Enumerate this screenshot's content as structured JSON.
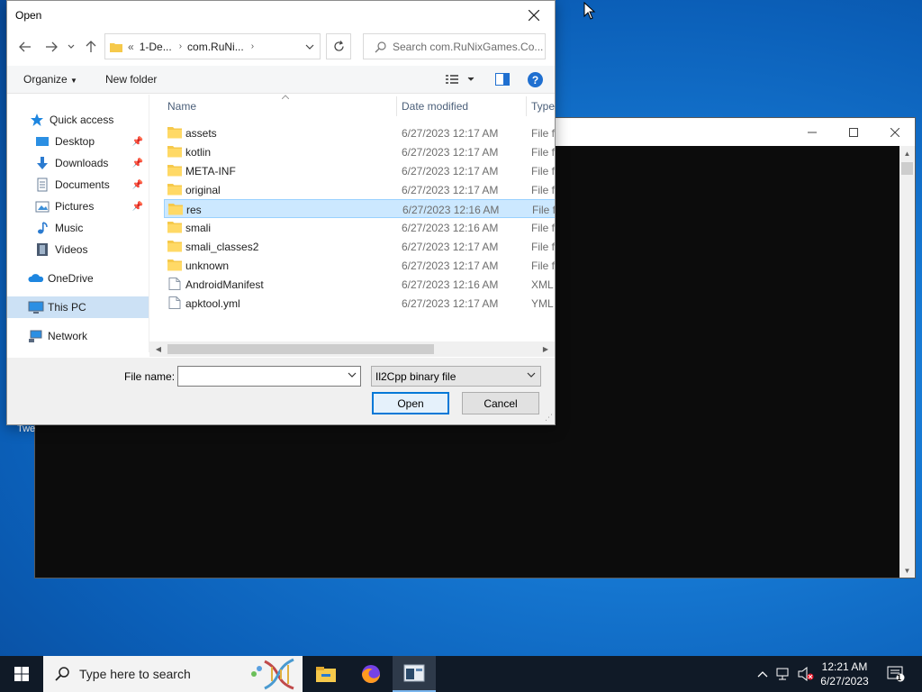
{
  "dialog": {
    "title": "Open",
    "address": {
      "overflow": "«",
      "crumbs": [
        "1-De...",
        "com.RuNi..."
      ]
    },
    "search_placeholder": "Search com.RuNixGames.Co...",
    "toolbar": {
      "organize": "Organize",
      "new_folder": "New folder"
    },
    "nav": {
      "quick_access": "Quick access",
      "desktop": "Desktop",
      "downloads": "Downloads",
      "documents": "Documents",
      "pictures": "Pictures",
      "music": "Music",
      "videos": "Videos",
      "onedrive": "OneDrive",
      "this_pc": "This PC",
      "network": "Network"
    },
    "columns": {
      "name": "Name",
      "date": "Date modified",
      "type": "Type"
    },
    "rows": [
      {
        "name": "assets",
        "date": "6/27/2023 12:17 AM",
        "type": "File fo",
        "icon": "folder-icon"
      },
      {
        "name": "kotlin",
        "date": "6/27/2023 12:17 AM",
        "type": "File fo",
        "icon": "folder-icon"
      },
      {
        "name": "META-INF",
        "date": "6/27/2023 12:17 AM",
        "type": "File fo",
        "icon": "folder-icon"
      },
      {
        "name": "original",
        "date": "6/27/2023 12:17 AM",
        "type": "File fo",
        "icon": "folder-icon"
      },
      {
        "name": "res",
        "date": "6/27/2023 12:16 AM",
        "type": "File fo",
        "icon": "folder-icon"
      },
      {
        "name": "smali",
        "date": "6/27/2023 12:16 AM",
        "type": "File fo",
        "icon": "folder-icon"
      },
      {
        "name": "smali_classes2",
        "date": "6/27/2023 12:17 AM",
        "type": "File fo",
        "icon": "folder-icon"
      },
      {
        "name": "unknown",
        "date": "6/27/2023 12:17 AM",
        "type": "File fo",
        "icon": "folder-icon"
      },
      {
        "name": "AndroidManifest",
        "date": "6/27/2023 12:16 AM",
        "type": "XML",
        "icon": "xml-file-icon"
      },
      {
        "name": "apktool.yml",
        "date": "6/27/2023 12:17 AM",
        "type": "YML",
        "icon": "file-icon"
      }
    ],
    "file_name_label": "File name:",
    "file_name_value": "",
    "file_type": "Il2Cpp binary file",
    "open_label": "Open",
    "cancel_label": "Cancel"
  },
  "desktop_fragments": {
    "left_text": "Twe"
  },
  "taskbar": {
    "search_placeholder": "Type here to search",
    "time": "12:21 AM",
    "date": "6/27/2023",
    "notification_count": "1"
  },
  "colors": {
    "accent": "#0078d7",
    "selection": "#cce8ff",
    "folder": "#f6c94b",
    "taskbar": "#101a27"
  }
}
